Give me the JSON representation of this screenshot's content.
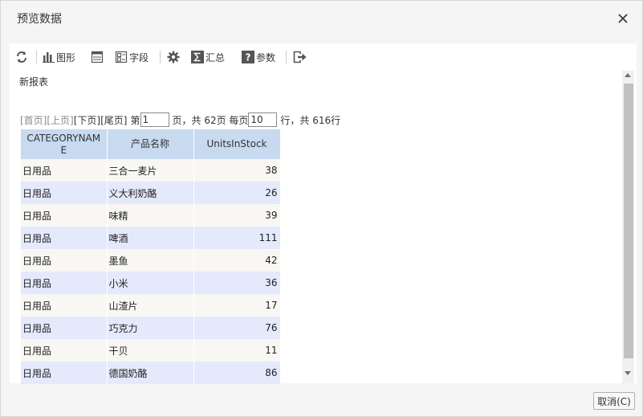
{
  "window": {
    "title": "预览数据"
  },
  "toolbar": {
    "chart_label": "图形",
    "fields_label": "字段",
    "summary_label": "汇总",
    "params_label": "参数"
  },
  "report": {
    "title": "新报表"
  },
  "pager": {
    "first": "[首页]",
    "prev": "[上页]",
    "next": "[下页]",
    "last": "[尾页]",
    "page_prefix": "第",
    "current_page": "1",
    "total_pages_text": "页，共 62页 每页",
    "page_size": "10",
    "total_rows_text": "行，共 616行"
  },
  "table": {
    "headers": [
      "CATEGORYNAME",
      "产品名称",
      "UnitsInStock"
    ],
    "rows": [
      [
        "日用品",
        "三合一麦片",
        "38"
      ],
      [
        "日用品",
        "义大利奶酪",
        "26"
      ],
      [
        "日用品",
        "味精",
        "39"
      ],
      [
        "日用品",
        "啤酒",
        "111"
      ],
      [
        "日用品",
        "墨鱼",
        "42"
      ],
      [
        "日用品",
        "小米",
        "36"
      ],
      [
        "日用品",
        "山渣片",
        "17"
      ],
      [
        "日用品",
        "巧克力",
        "76"
      ],
      [
        "日用品",
        "干贝",
        "11"
      ],
      [
        "日用品",
        "德国奶酪",
        "86"
      ]
    ]
  },
  "footer": {
    "cancel_label": "取消(C)"
  },
  "icons": [
    "refresh-icon",
    "bar-chart-icon",
    "layout-icon",
    "fields-icon",
    "gear-icon",
    "sigma-icon",
    "question-icon",
    "exit-icon",
    "close-icon"
  ]
}
